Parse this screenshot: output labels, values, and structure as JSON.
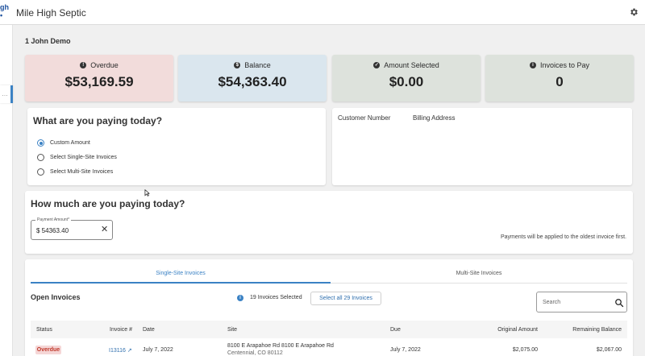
{
  "header": {
    "logo_text": "gh",
    "app_title": "Mile High Septic"
  },
  "account": {
    "name": "1 John Demo"
  },
  "summary": {
    "overdue": {
      "label": "Overdue",
      "value": "$53,169.59",
      "color": "#f2dcdb"
    },
    "balance": {
      "label": "Balance",
      "value": "$54,363.40",
      "color": "#dae6ee"
    },
    "selected": {
      "label": "Amount Selected",
      "value": "$0.00",
      "color": "#dde2dc"
    },
    "to_pay": {
      "label": "Invoices to Pay",
      "value": "0",
      "color": "#dde2dc"
    }
  },
  "paying": {
    "title": "What are you paying today?",
    "options": [
      "Custom Amount",
      "Select Single-Site Invoices",
      "Select Multi-Site Invoices"
    ],
    "selected_index": 0
  },
  "customer": {
    "number_label": "Customer Number",
    "billing_label": "Billing Address"
  },
  "amount": {
    "title": "How much are you paying today?",
    "field_label": "Payment Amount*",
    "field_value": "$ 54363.40",
    "note": "Payments will be applied to the oldest invoice first."
  },
  "tabs": {
    "single": "Single-Site Invoices",
    "multi": "Multi-Site Invoices",
    "active": "single"
  },
  "invoices": {
    "title": "Open Invoices",
    "selected_text": "19 Invoices Selected",
    "select_all_label": "Select all 29 Invoices",
    "search_placeholder": "Search",
    "columns": [
      "Status",
      "Invoice #",
      "Date",
      "Site",
      "Due",
      "Original Amount",
      "Remaining Balance"
    ],
    "rows": [
      {
        "status": "Overdue",
        "invoice": "I13116",
        "date": "July 7, 2022",
        "site_line1": "8100 E Arapahoe Rd 8100 E Arapahoe Rd",
        "site_line2": "Centennial, CO 80112",
        "due": "July 7, 2022",
        "original": "$2,075.00",
        "remaining": "$2,067.00"
      }
    ]
  },
  "colors": {
    "accent": "#3b82c4",
    "overdue_text": "#c0392b"
  }
}
